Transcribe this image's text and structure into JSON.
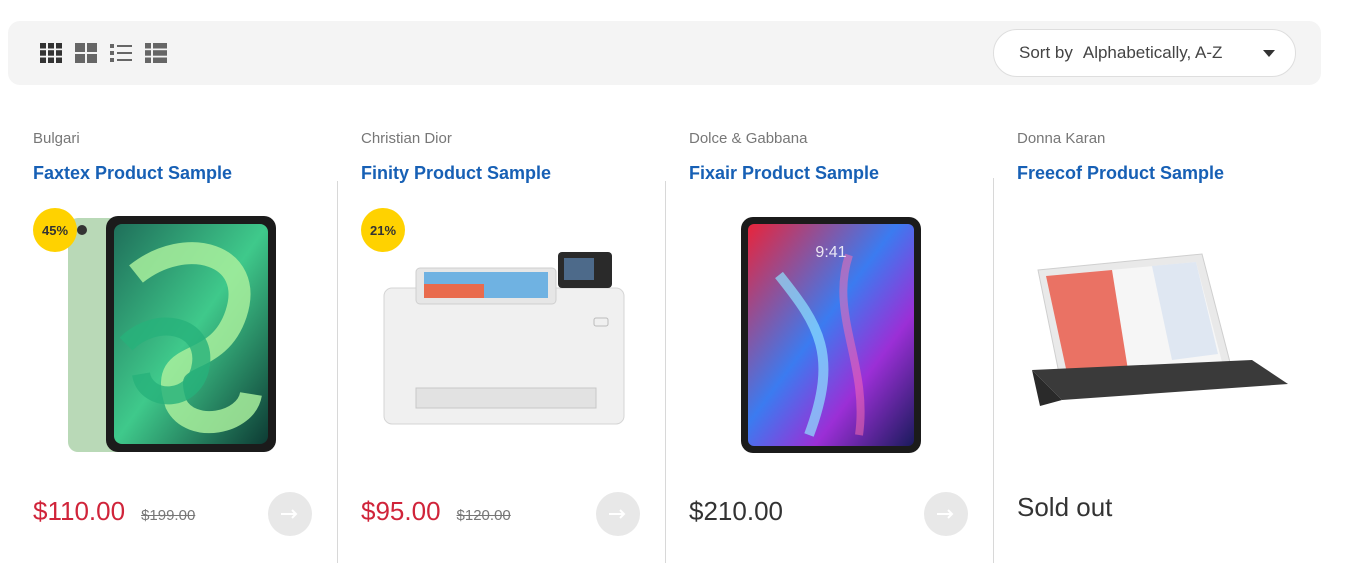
{
  "toolbar": {
    "views": [
      {
        "name": "grid-4-icon"
      },
      {
        "name": "grid-2-icon"
      },
      {
        "name": "list-icon"
      },
      {
        "name": "list-wide-icon"
      }
    ],
    "sort": {
      "label": "Sort by",
      "value": "Alphabetically, A-Z"
    }
  },
  "products": [
    {
      "brand": "Bulgari",
      "title": "Faxtex Product Sample",
      "badge": "45%",
      "price": "$110.00",
      "old_price": "$199.00",
      "image": "tablet-green-icon"
    },
    {
      "brand": "Christian Dior",
      "title": "Finity Product Sample",
      "badge": "21%",
      "price": "$95.00",
      "old_price": "$120.00",
      "image": "printer-icon"
    },
    {
      "brand": "Dolce & Gabbana",
      "title": "Fixair Product Sample",
      "price": "$210.00",
      "image": "tablet-pro-icon"
    },
    {
      "brand": "Donna Karan",
      "title": "Freecof Product Sample",
      "status": "Sold out",
      "image": "tablet-keyboard-icon"
    }
  ],
  "colors": {
    "accent": "#1760b5",
    "sale": "#d0243a",
    "badge": "#ffd200"
  }
}
